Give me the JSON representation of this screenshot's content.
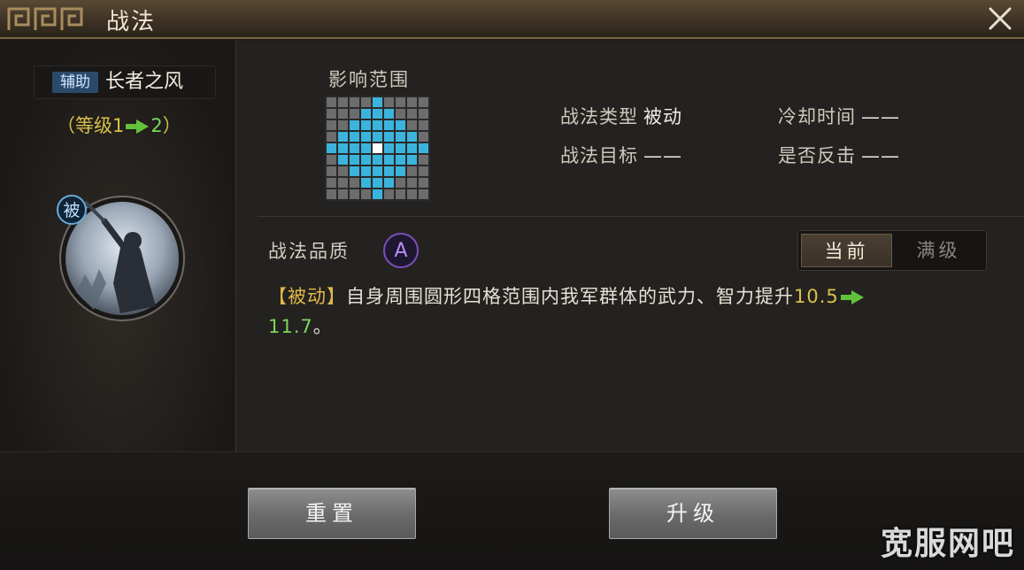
{
  "window": {
    "title": "战法",
    "close_icon": "close-icon"
  },
  "skill": {
    "type_tag": "辅助",
    "name": "长者之风",
    "level_prefix": "（等级1",
    "level_to": "2",
    "level_suffix": "）",
    "passive_badge": "被",
    "icon": "warrior-raising-sword-icon"
  },
  "range": {
    "label": "影响范围",
    "grid_size": 9,
    "active_cells": [
      [
        0,
        4
      ],
      [
        1,
        3
      ],
      [
        1,
        4
      ],
      [
        1,
        5
      ],
      [
        2,
        2
      ],
      [
        2,
        3
      ],
      [
        2,
        4
      ],
      [
        2,
        5
      ],
      [
        2,
        6
      ],
      [
        3,
        1
      ],
      [
        3,
        2
      ],
      [
        3,
        3
      ],
      [
        3,
        4
      ],
      [
        3,
        5
      ],
      [
        3,
        6
      ],
      [
        3,
        7
      ],
      [
        4,
        0
      ],
      [
        4,
        1
      ],
      [
        4,
        2
      ],
      [
        4,
        3
      ],
      [
        4,
        5
      ],
      [
        4,
        6
      ],
      [
        4,
        7
      ],
      [
        4,
        8
      ],
      [
        5,
        1
      ],
      [
        5,
        2
      ],
      [
        5,
        3
      ],
      [
        5,
        4
      ],
      [
        5,
        5
      ],
      [
        5,
        6
      ],
      [
        5,
        7
      ],
      [
        6,
        2
      ],
      [
        6,
        3
      ],
      [
        6,
        4
      ],
      [
        6,
        5
      ],
      [
        6,
        6
      ],
      [
        7,
        3
      ],
      [
        7,
        4
      ],
      [
        7,
        5
      ],
      [
        8,
        4
      ]
    ],
    "center_cell": [
      4,
      4
    ],
    "colors": {
      "on": "#3bb4dd",
      "off": "#6d6d6d",
      "center": "#ffffff"
    }
  },
  "info": {
    "type_label": "战法类型",
    "type_value": "被动",
    "target_label": "战法目标",
    "target_value": "——",
    "cooldown_label": "冷却时间",
    "cooldown_value": "——",
    "counter_label": "是否反击",
    "counter_value": "——"
  },
  "quality": {
    "label": "战法品质",
    "grade": "A"
  },
  "toggle": {
    "current": "当前",
    "max": "满级"
  },
  "description": {
    "tag": "【被动】",
    "text": "自身周围圆形四格范围内我军群体的武力、智力提升",
    "from": "10.5",
    "to": "11.7",
    "end": "。"
  },
  "buttons": {
    "reset": "重置",
    "upgrade": "升级"
  },
  "watermark": "宽服网吧",
  "colors": {
    "accent_gold": "#d9c04a",
    "upgrade_green": "#7cd65b",
    "range_blue": "#3bb4dd",
    "grade_purple": "#7a4fb8"
  }
}
